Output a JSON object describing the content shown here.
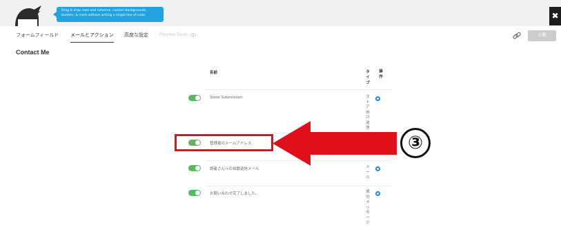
{
  "promo": {
    "line1": "Drag & drop rows and columns, custom backgrounds,",
    "line2": "borders, & more without writing a single line of code."
  },
  "close_label": "✖",
  "tabs": [
    {
      "label": "フォームフィールド"
    },
    {
      "label": "メールとアクション"
    },
    {
      "label": "高度な設定"
    },
    {
      "label": "Preview Form"
    }
  ],
  "publish_label": "公開",
  "form_title": "Contact Me",
  "table": {
    "headers": {
      "name": "名前",
      "type": "タイプ",
      "ops": "操作"
    },
    "rows": [
      {
        "name": "Store Submission",
        "type": "ストア向け送信",
        "enabled": true
      },
      {
        "name": "管理者のメールアドレス",
        "type": "ル",
        "enabled": true
      },
      {
        "name": "読者さんへの自動返信メール",
        "type": "メール",
        "enabled": true
      },
      {
        "name": "お問い合わせ完了しました。",
        "type": "成功メッセージ",
        "enabled": true
      }
    ]
  },
  "annotation": {
    "number": "③",
    "color": "#e0101a"
  },
  "colors": {
    "toggle_on": "#5cb85c",
    "gear": "#1b8ad6",
    "promo_bg": "#22a3e0"
  }
}
